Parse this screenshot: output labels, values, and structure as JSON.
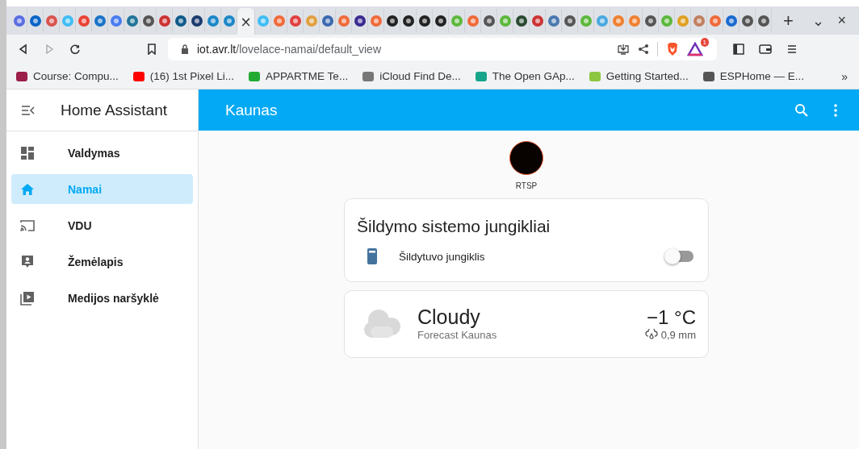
{
  "browser": {
    "tabs": [
      {
        "color": "#5b6ee1",
        "selected": false
      },
      {
        "color": "#0a64c8",
        "selected": false
      },
      {
        "color": "#d9534f",
        "selected": false
      },
      {
        "color": "#41bdf5",
        "selected": false
      },
      {
        "color": "#ea4335",
        "selected": false
      },
      {
        "color": "#1a73c8",
        "selected": false
      },
      {
        "color": "#4a7df0",
        "selected": false
      },
      {
        "color": "#21759b",
        "selected": false
      },
      {
        "color": "#555555",
        "selected": false
      },
      {
        "color": "#cc3333",
        "selected": false
      },
      {
        "color": "#0f5a8a",
        "selected": false
      },
      {
        "color": "#1c3b6e",
        "selected": false
      },
      {
        "color": "#1e88c8",
        "selected": false
      },
      {
        "color": "#1e88c8",
        "selected": false
      },
      {
        "selected": true,
        "close": "×"
      },
      {
        "color": "#41bdf5",
        "selected": false
      },
      {
        "color": "#f06a3a",
        "selected": false
      },
      {
        "color": "#e04040",
        "selected": false
      },
      {
        "color": "#e0a040",
        "selected": false
      },
      {
        "color": "#3a6ab0",
        "selected": false
      },
      {
        "color": "#f06a3a",
        "selected": false
      },
      {
        "color": "#3a2a90",
        "selected": false
      },
      {
        "color": "#f06a3a",
        "selected": false
      },
      {
        "color": "#222222",
        "selected": false
      },
      {
        "color": "#222222",
        "selected": false
      },
      {
        "color": "#222222",
        "selected": false
      },
      {
        "color": "#222222",
        "selected": false
      },
      {
        "color": "#5cb83c",
        "selected": false
      },
      {
        "color": "#f06a3a",
        "selected": false
      },
      {
        "color": "#555555",
        "selected": false
      },
      {
        "color": "#5cb83c",
        "selected": false
      },
      {
        "color": "#2a4a30",
        "selected": false
      },
      {
        "color": "#cc3333",
        "selected": false
      },
      {
        "color": "#4a78b0",
        "selected": false
      },
      {
        "color": "#555555",
        "selected": false
      },
      {
        "color": "#5cb83c",
        "selected": false
      },
      {
        "color": "#4aa8e0",
        "selected": false
      },
      {
        "color": "#f08030",
        "selected": false
      },
      {
        "color": "#f08030",
        "selected": false
      },
      {
        "color": "#555555",
        "selected": false
      },
      {
        "color": "#5cb83c",
        "selected": false
      },
      {
        "color": "#e0a020",
        "selected": false
      },
      {
        "color": "#c08060",
        "selected": false
      },
      {
        "color": "#f06a3a",
        "selected": false
      },
      {
        "color": "#1a6ad0",
        "selected": false
      },
      {
        "color": "#555555",
        "selected": false
      },
      {
        "color": "#555555",
        "selected": false
      }
    ],
    "new_tab": "+",
    "tab_menu": "⌄",
    "close_window": "×",
    "url_host": "iot.avr.lt",
    "url_path": "/lovelace-namai/default_view",
    "notification_count": "1",
    "bookmarks": [
      {
        "label": "Course: Compu...",
        "color": "#9c1f4a"
      },
      {
        "label": "(16) 1st Pixel Li...",
        "color": "#ff0000"
      },
      {
        "label": "APPARTME Te...",
        "color": "#22aa33"
      },
      {
        "label": "iCloud Find De...",
        "color": "#777777"
      },
      {
        "label": "The Open GAp...",
        "color": "#17a58a"
      },
      {
        "label": "Getting Started...",
        "color": "#8cc63f"
      },
      {
        "label": "ESPHome — E...",
        "color": "#555555"
      }
    ],
    "more_bookmarks": "»"
  },
  "sidebar": {
    "title": "Home Assistant",
    "items": [
      {
        "label": "Valdymas",
        "kind": "dashboard",
        "selected": false
      },
      {
        "label": "Namai",
        "kind": "home",
        "selected": true
      },
      {
        "label": "VDU",
        "kind": "cast",
        "selected": false
      },
      {
        "label": "Žemėlapis",
        "kind": "map",
        "selected": false
      },
      {
        "label": "Medijos naršyklė",
        "kind": "media",
        "selected": false
      }
    ]
  },
  "header": {
    "title": "Kaunas"
  },
  "badge": {
    "label": "RTSP"
  },
  "switch_card": {
    "title": "Šildymo sistemo jungikliai",
    "rows": [
      {
        "label": "Šildytuvo jungiklis",
        "on": false
      }
    ]
  },
  "weather_card": {
    "condition": "Cloudy",
    "subtitle": "Forecast Kaunas",
    "temperature": "−1 °C",
    "precipitation": "0,9 mm"
  }
}
